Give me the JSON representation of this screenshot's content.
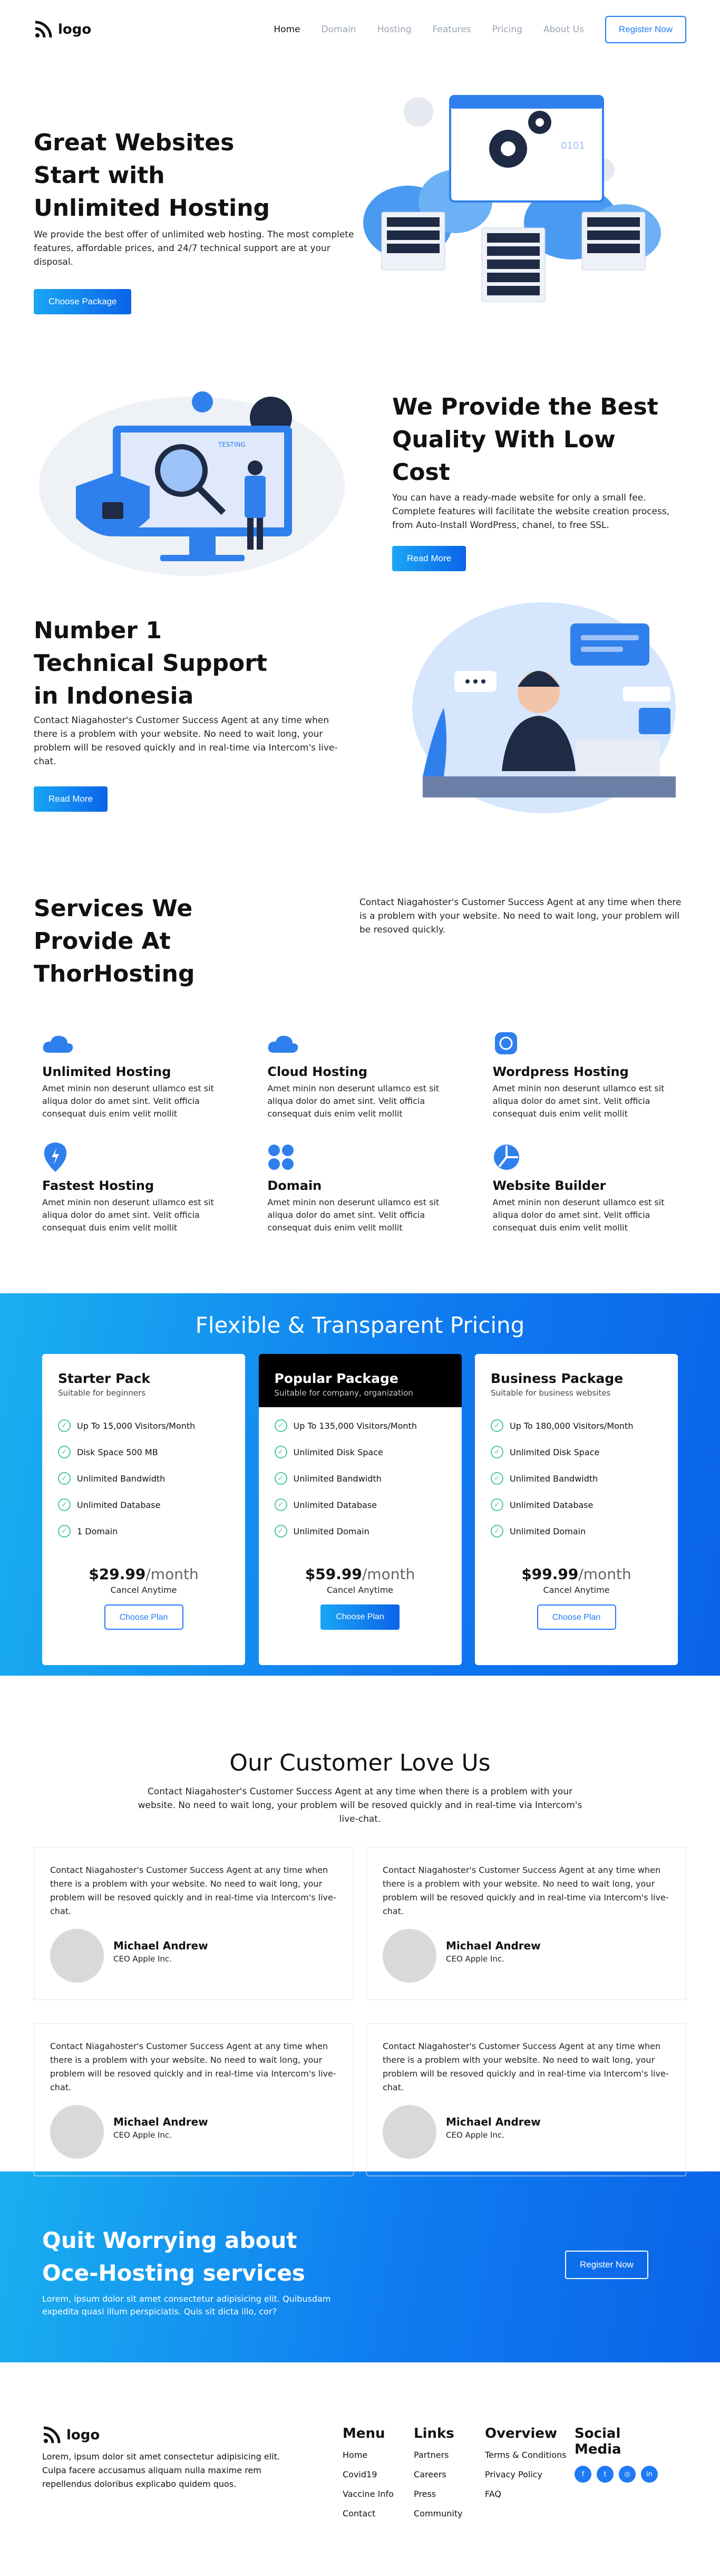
{
  "nav": {
    "logo": "logo",
    "links": [
      "Home",
      "Domain",
      "Hosting",
      "Features",
      "Pricing",
      "About Us"
    ],
    "register": "Register Now"
  },
  "hero": {
    "title": "Great Websites Start with Unlimited Hosting",
    "text": "We provide the best offer of unlimited web hosting. The most complete features, affordable prices, and 24/7 technical support are at your disposal.",
    "button": "Choose Package",
    "server_text": "0101"
  },
  "quality": {
    "title": "We Provide the Best Quality With Low Cost",
    "text": "You can have a ready-made website for only a small fee. Complete features will facilitate the website creation process, from Auto-Install WordPress, chanel, to free SSL.",
    "button": "Read More",
    "screen_label": "TESTING"
  },
  "support": {
    "title": "Number 1 Technical Support in Indonesia",
    "text": "Contact Niagahoster's Customer Success Agent at any time when there is a problem with your website. No need to wait long, your problem will be resoved quickly and in real-time via Intercom's live-chat.",
    "button": "Read More"
  },
  "services": {
    "title": "Services We Provide At ThorHosting",
    "text": "Contact Niagahoster's Customer Success Agent at any time when there is a problem with your website. No need to wait long, your problem will be resoved quickly.",
    "items": [
      {
        "title": "Unlimited Hosting",
        "desc": "Amet minin non deserunt ullamco est sit aliqua dolor do amet sint. Velit officia consequat duis enim velit mollit",
        "icon": "cloud-icon"
      },
      {
        "title": "Cloud Hosting",
        "desc": "Amet minin non deserunt ullamco est sit aliqua dolor do amet sint. Velit officia consequat duis enim velit mollit",
        "icon": "cloud-icon"
      },
      {
        "title": "Wordpress Hosting",
        "desc": "Amet minin non deserunt ullamco est sit aliqua dolor do amet sint. Velit officia consequat duis enim velit mollit",
        "icon": "wordpress-icon"
      },
      {
        "title": "Fastest Hosting",
        "desc": "Amet minin non deserunt ullamco est sit aliqua dolor do amet sint. Velit officia consequat duis enim velit mollit",
        "icon": "lightning-icon"
      },
      {
        "title": "Domain",
        "desc": "Amet minin non deserunt ullamco est sit aliqua dolor do amet sint. Velit officia consequat duis enim velit mollit",
        "icon": "grid-dots-icon"
      },
      {
        "title": "Website Builder",
        "desc": "Amet minin non deserunt ullamco est sit aliqua dolor do amet sint. Velit officia consequat duis enim velit mollit",
        "icon": "pie-icon"
      }
    ]
  },
  "pricing": {
    "title": "Flexible & Transparent Pricing",
    "plans": [
      {
        "name": "Starter Pack",
        "sub": "Suitable for beginners",
        "features": [
          "Up To 15,000 Visitors/Month",
          "Disk Space 500 MB",
          "Unlimited Bandwidth",
          "Unlimited Database",
          "1 Domain"
        ],
        "price": "$29.99",
        "period": "/month",
        "cancel": "Cancel Anytime",
        "button": "Choose Plan"
      },
      {
        "name": "Popular Package",
        "sub": "Suitable for company, organization",
        "features": [
          "Up To 135,000 Visitors/Month",
          "Unlimited Disk Space",
          "Unlimited Bandwidth",
          "Unlimited Database",
          "Unlimited Domain"
        ],
        "price": "$59.99",
        "period": "/month",
        "cancel": "Cancel Anytime",
        "button": "Choose Plan"
      },
      {
        "name": "Business Package",
        "sub": "Suitable for business websites",
        "features": [
          "Up To 180,000 Visitors/Month",
          "Unlimited Disk Space",
          "Unlimited Bandwidth",
          "Unlimited Database",
          "Unlimited Domain"
        ],
        "price": "$99.99",
        "period": "/month",
        "cancel": "Cancel Anytime",
        "button": "Choose Plan"
      }
    ]
  },
  "testimonials": {
    "title": "Our Customer Love Us",
    "text": "Contact Niagahoster's Customer Success Agent at any time when there is a problem with your website. No need to wait long, your problem will be resoved quickly and in real-time via Intercom's live-chat.",
    "items": [
      {
        "quote": "Contact Niagahoster's Customer Success Agent at any time when there is a problem with your website. No need to wait long, your problem will be resoved quickly and in real-time via Intercom's live-chat.",
        "name": "Michael Andrew",
        "role": "CEO Apple Inc."
      },
      {
        "quote": "Contact Niagahoster's Customer Success Agent at any time when there is a problem with your website. No need to wait long, your problem will be resoved quickly and in real-time via Intercom's live-chat.",
        "name": "Michael Andrew",
        "role": "CEO Apple Inc."
      },
      {
        "quote": "Contact Niagahoster's Customer Success Agent at any time when there is a problem with your website. No need to wait long, your problem will be resoved quickly and in real-time via Intercom's live-chat.",
        "name": "Michael Andrew",
        "role": "CEO Apple Inc."
      },
      {
        "quote": "Contact Niagahoster's Customer Success Agent at any time when there is a problem with your website. No need to wait long, your problem will be resoved quickly and in real-time via Intercom's live-chat.",
        "name": "Michael Andrew",
        "role": "CEO Apple Inc."
      }
    ]
  },
  "cta": {
    "title": "Quit Worrying about Oce-Hosting services",
    "text": "Lorem, ipsum dolor sit amet consectetur adipisicing elit. Quibusdam expedita quasi illum perspiciatis. Quis sit dicta illo, cor?",
    "button": "Register Now"
  },
  "footer": {
    "logo": "logo",
    "text": "Lorem, ipsum dolor sit amet consectetur adipisicing elit. Culpa facere accusamus aliquam nulla maxime rem repellendus doloribus explicabo quidem quos.",
    "menu": {
      "title": "Menu",
      "links": [
        "Home",
        "Covid19",
        "Vaccine Info",
        "Contact"
      ]
    },
    "links": {
      "title": "Links",
      "links": [
        "Partners",
        "Careers",
        "Press",
        "Community"
      ]
    },
    "overview": {
      "title": "Overview",
      "links": [
        "Terms & Conditions",
        "Privacy Policy",
        "FAQ"
      ]
    },
    "social": {
      "title": "Social Media",
      "icons": [
        "facebook-icon",
        "twitter-icon",
        "instagram-icon",
        "linkedin-icon"
      ]
    }
  },
  "colors": {
    "primary": "#1f7af5",
    "gradient_start": "#1ab0f0",
    "gradient_end": "#0a63e8",
    "check": "#4bc7a8"
  }
}
